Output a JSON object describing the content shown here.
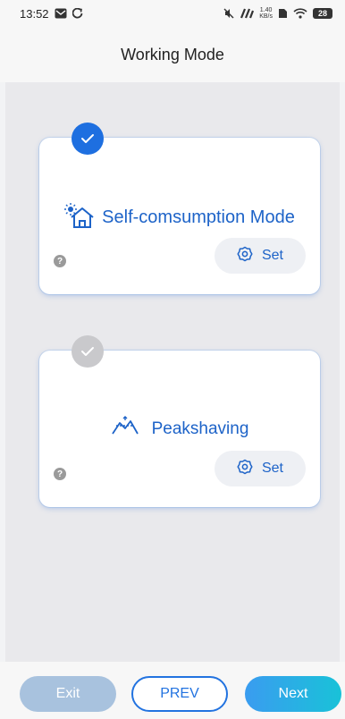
{
  "status_bar": {
    "time": "13:52",
    "network_speed_top": "1.40",
    "network_speed_bottom": "KB/s",
    "battery": "28"
  },
  "header": {
    "title": "Working Mode"
  },
  "modes": [
    {
      "label": "Self-comsumption Mode",
      "selected": true,
      "icon": "home-sun-icon",
      "set_label": "Set",
      "help": "?"
    },
    {
      "label": "Peakshaving",
      "selected": false,
      "icon": "peak-chart-icon",
      "set_label": "Set",
      "help": "?"
    }
  ],
  "footer": {
    "exit_label": "Exit",
    "prev_label": "PREV",
    "next_label": "Next"
  },
  "colors": {
    "accent": "#1d63c8",
    "selected_check": "#1e6fe0",
    "unselected_check": "#c9c9cc",
    "exit_disabled": "#a8c2de",
    "next_gradient_start": "#3a9cf0",
    "next_gradient_end": "#19c2d8"
  }
}
